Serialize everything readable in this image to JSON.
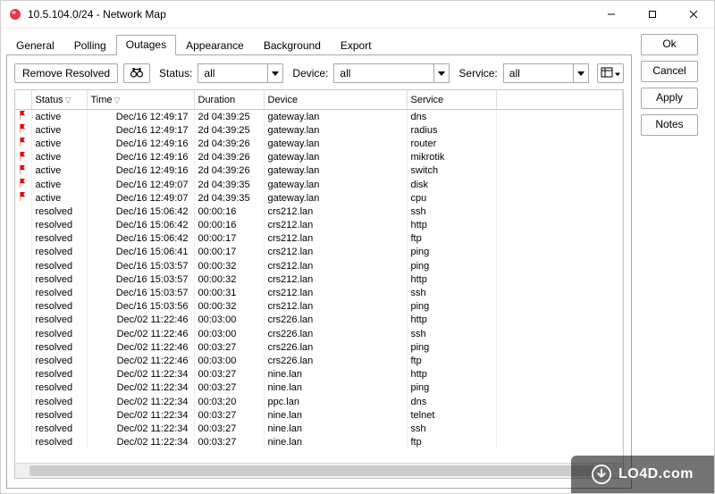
{
  "window": {
    "title": "10.5.104.0/24 - Network Map"
  },
  "tabs": [
    "General",
    "Polling",
    "Outages",
    "Appearance",
    "Background",
    "Export"
  ],
  "active_tab_index": 2,
  "side_buttons": [
    "Ok",
    "Cancel",
    "Apply",
    "Notes"
  ],
  "toolbar": {
    "remove_resolved": "Remove Resolved",
    "status_label": "Status:",
    "device_label": "Device:",
    "service_label": "Service:",
    "status_value": "all",
    "device_value": "all",
    "service_value": "all"
  },
  "columns": [
    "",
    "Status",
    "Time",
    "Duration",
    "Device",
    "Service",
    ""
  ],
  "rows": [
    {
      "flag": true,
      "status": "active",
      "time": "Dec/16 12:49:17",
      "duration": "2d 04:39:25",
      "device": "gateway.lan",
      "service": "dns"
    },
    {
      "flag": true,
      "status": "active",
      "time": "Dec/16 12:49:17",
      "duration": "2d 04:39:25",
      "device": "gateway.lan",
      "service": "radius"
    },
    {
      "flag": true,
      "status": "active",
      "time": "Dec/16 12:49:16",
      "duration": "2d 04:39:26",
      "device": "gateway.lan",
      "service": "router"
    },
    {
      "flag": true,
      "status": "active",
      "time": "Dec/16 12:49:16",
      "duration": "2d 04:39:26",
      "device": "gateway.lan",
      "service": "mikrotik"
    },
    {
      "flag": true,
      "status": "active",
      "time": "Dec/16 12:49:16",
      "duration": "2d 04:39:26",
      "device": "gateway.lan",
      "service": "switch"
    },
    {
      "flag": true,
      "status": "active",
      "time": "Dec/16 12:49:07",
      "duration": "2d 04:39:35",
      "device": "gateway.lan",
      "service": "disk"
    },
    {
      "flag": true,
      "status": "active",
      "time": "Dec/16 12:49:07",
      "duration": "2d 04:39:35",
      "device": "gateway.lan",
      "service": "cpu"
    },
    {
      "flag": false,
      "status": "resolved",
      "time": "Dec/16 15:06:42",
      "duration": "00:00:16",
      "device": "crs212.lan",
      "service": "ssh"
    },
    {
      "flag": false,
      "status": "resolved",
      "time": "Dec/16 15:06:42",
      "duration": "00:00:16",
      "device": "crs212.lan",
      "service": "http"
    },
    {
      "flag": false,
      "status": "resolved",
      "time": "Dec/16 15:06:42",
      "duration": "00:00:17",
      "device": "crs212.lan",
      "service": "ftp"
    },
    {
      "flag": false,
      "status": "resolved",
      "time": "Dec/16 15:06:41",
      "duration": "00:00:17",
      "device": "crs212.lan",
      "service": "ping"
    },
    {
      "flag": false,
      "status": "resolved",
      "time": "Dec/16 15:03:57",
      "duration": "00:00:32",
      "device": "crs212.lan",
      "service": "ping"
    },
    {
      "flag": false,
      "status": "resolved",
      "time": "Dec/16 15:03:57",
      "duration": "00:00:32",
      "device": "crs212.lan",
      "service": "http"
    },
    {
      "flag": false,
      "status": "resolved",
      "time": "Dec/16 15:03:57",
      "duration": "00:00:31",
      "device": "crs212.lan",
      "service": "ssh"
    },
    {
      "flag": false,
      "status": "resolved",
      "time": "Dec/16 15:03:56",
      "duration": "00:00:32",
      "device": "crs212.lan",
      "service": "ping"
    },
    {
      "flag": false,
      "status": "resolved",
      "time": "Dec/02 11:22:46",
      "duration": "00:03:00",
      "device": "crs226.lan",
      "service": "http"
    },
    {
      "flag": false,
      "status": "resolved",
      "time": "Dec/02 11:22:46",
      "duration": "00:03:00",
      "device": "crs226.lan",
      "service": "ssh"
    },
    {
      "flag": false,
      "status": "resolved",
      "time": "Dec/02 11:22:46",
      "duration": "00:03:27",
      "device": "crs226.lan",
      "service": "ping"
    },
    {
      "flag": false,
      "status": "resolved",
      "time": "Dec/02 11:22:46",
      "duration": "00:03:00",
      "device": "crs226.lan",
      "service": "ftp"
    },
    {
      "flag": false,
      "status": "resolved",
      "time": "Dec/02 11:22:34",
      "duration": "00:03:27",
      "device": "nine.lan",
      "service": "http"
    },
    {
      "flag": false,
      "status": "resolved",
      "time": "Dec/02 11:22:34",
      "duration": "00:03:27",
      "device": "nine.lan",
      "service": "ping"
    },
    {
      "flag": false,
      "status": "resolved",
      "time": "Dec/02 11:22:34",
      "duration": "00:03:20",
      "device": "ppc.lan",
      "service": "dns"
    },
    {
      "flag": false,
      "status": "resolved",
      "time": "Dec/02 11:22:34",
      "duration": "00:03:27",
      "device": "nine.lan",
      "service": "telnet"
    },
    {
      "flag": false,
      "status": "resolved",
      "time": "Dec/02 11:22:34",
      "duration": "00:03:27",
      "device": "nine.lan",
      "service": "ssh"
    },
    {
      "flag": false,
      "status": "resolved",
      "time": "Dec/02 11:22:34",
      "duration": "00:03:27",
      "device": "nine.lan",
      "service": "ftp"
    }
  ],
  "watermark": "LO4D.com"
}
